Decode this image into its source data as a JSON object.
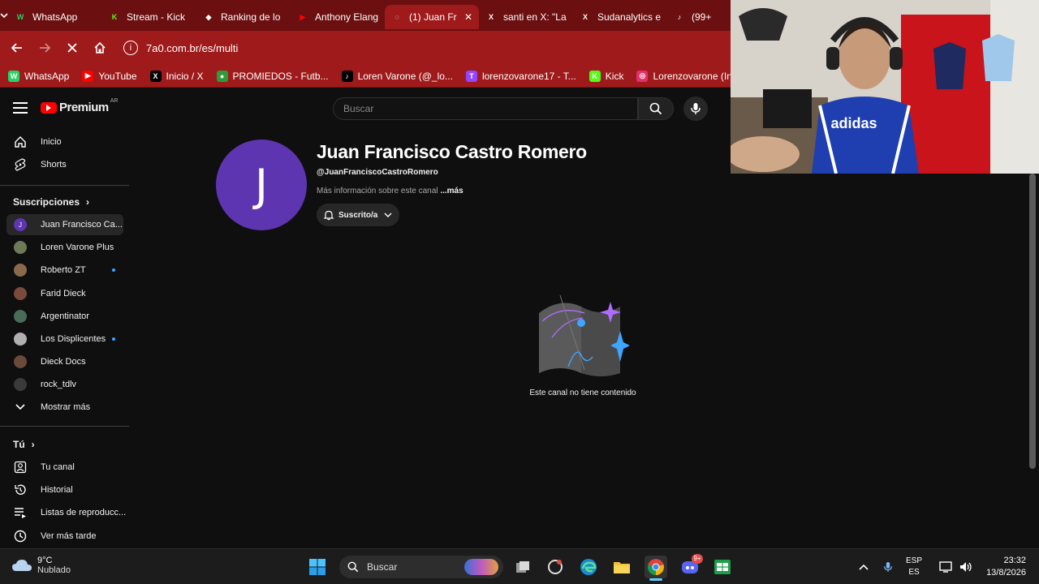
{
  "browser": {
    "tabs": [
      {
        "title": "WhatsApp",
        "icon": "whatsapp-icon",
        "color": "#25d366"
      },
      {
        "title": "Stream - Kick",
        "icon": "kick-icon",
        "color": "#53fc18"
      },
      {
        "title": "Ranking de lo",
        "icon": "diamond-icon",
        "color": "#ffffff"
      },
      {
        "title": "Anthony Elang",
        "icon": "youtube-icon",
        "color": "#ff0000"
      },
      {
        "title": "(1) Juan Fr",
        "icon": "loading-icon",
        "color": "#ffffff",
        "active": true
      },
      {
        "title": "santi en X: \"La",
        "icon": "x-icon",
        "color": "#ffffff"
      },
      {
        "title": "Sudanalytics e",
        "icon": "x-icon",
        "color": "#ffffff"
      },
      {
        "title": "(99+",
        "icon": "tiktok-icon",
        "color": "#ffffff"
      }
    ],
    "url": "7a0.com.br/es/multi",
    "bookmarks": [
      {
        "label": "WhatsApp",
        "icon": "whatsapp-icon",
        "color": "#25d366"
      },
      {
        "label": "YouTube",
        "icon": "youtube-icon",
        "color": "#ff0000"
      },
      {
        "label": "Inicio / X",
        "icon": "x-icon",
        "color": "#000000"
      },
      {
        "label": "PROMIEDOS - Futb...",
        "icon": "promiedos-icon",
        "color": "#2e9b3a"
      },
      {
        "label": "Loren Varone (@_lo...",
        "icon": "tiktok-icon",
        "color": "#000000"
      },
      {
        "label": "lorenzovarone17 - T...",
        "icon": "twitch-icon",
        "color": "#9146ff"
      },
      {
        "label": "Kick",
        "icon": "kick-icon",
        "color": "#53fc18"
      },
      {
        "label": "Lorenzovarone (Inst...",
        "icon": "instagram-icon",
        "color": "#e1306c"
      }
    ]
  },
  "youtube": {
    "logo_text": "Premium",
    "country": "AR",
    "search_placeholder": "Buscar",
    "sidebar": {
      "main": [
        {
          "label": "Inicio",
          "icon": "home-icon"
        },
        {
          "label": "Shorts",
          "icon": "shorts-icon"
        }
      ],
      "subscriptions_header": "Suscripciones",
      "subscriptions": [
        {
          "label": "Juan Francisco Ca...",
          "color": "#5e35b1",
          "initial": "J",
          "selected": true,
          "new": false
        },
        {
          "label": "Loren Varone Plus",
          "color": "#6d7a55",
          "new": false
        },
        {
          "label": "Roberto ZT",
          "color": "#8a6a4a",
          "new": true
        },
        {
          "label": "Farid Dieck",
          "color": "#7a4a3a",
          "new": false
        },
        {
          "label": "Argentinator",
          "color": "#4a6a5a",
          "new": false
        },
        {
          "label": "Los Displicentes",
          "color": "#b0b0b0",
          "new": true
        },
        {
          "label": "Dieck Docs",
          "color": "#6a4a3a",
          "new": false
        },
        {
          "label": "rock_tdlv",
          "color": "#3a3a3a",
          "new": false
        }
      ],
      "show_more": "Mostrar más",
      "you_header": "Tú",
      "you": [
        {
          "label": "Tu canal",
          "icon": "user-icon"
        },
        {
          "label": "Historial",
          "icon": "history-icon"
        },
        {
          "label": "Listas de reproducc...",
          "icon": "playlist-icon"
        },
        {
          "label": "Ver más tarde",
          "icon": "clock-icon"
        }
      ]
    },
    "channel": {
      "initial": "J",
      "name": "Juan Francisco Castro Romero",
      "handle": "@JuanFranciscoCastroRomero",
      "info": "Más información sobre este canal",
      "more": "...más",
      "subscribe_label": "Suscrito/a",
      "empty_message": "Este canal no tiene contenido"
    }
  },
  "taskbar": {
    "weather_temp": "9°C",
    "weather_desc": "Nublado",
    "search_label": "Buscar",
    "lang_top": "ESP",
    "lang_bottom": "ES",
    "time": "23:32",
    "date": "13/8/2026",
    "discord_badge": "9+"
  }
}
